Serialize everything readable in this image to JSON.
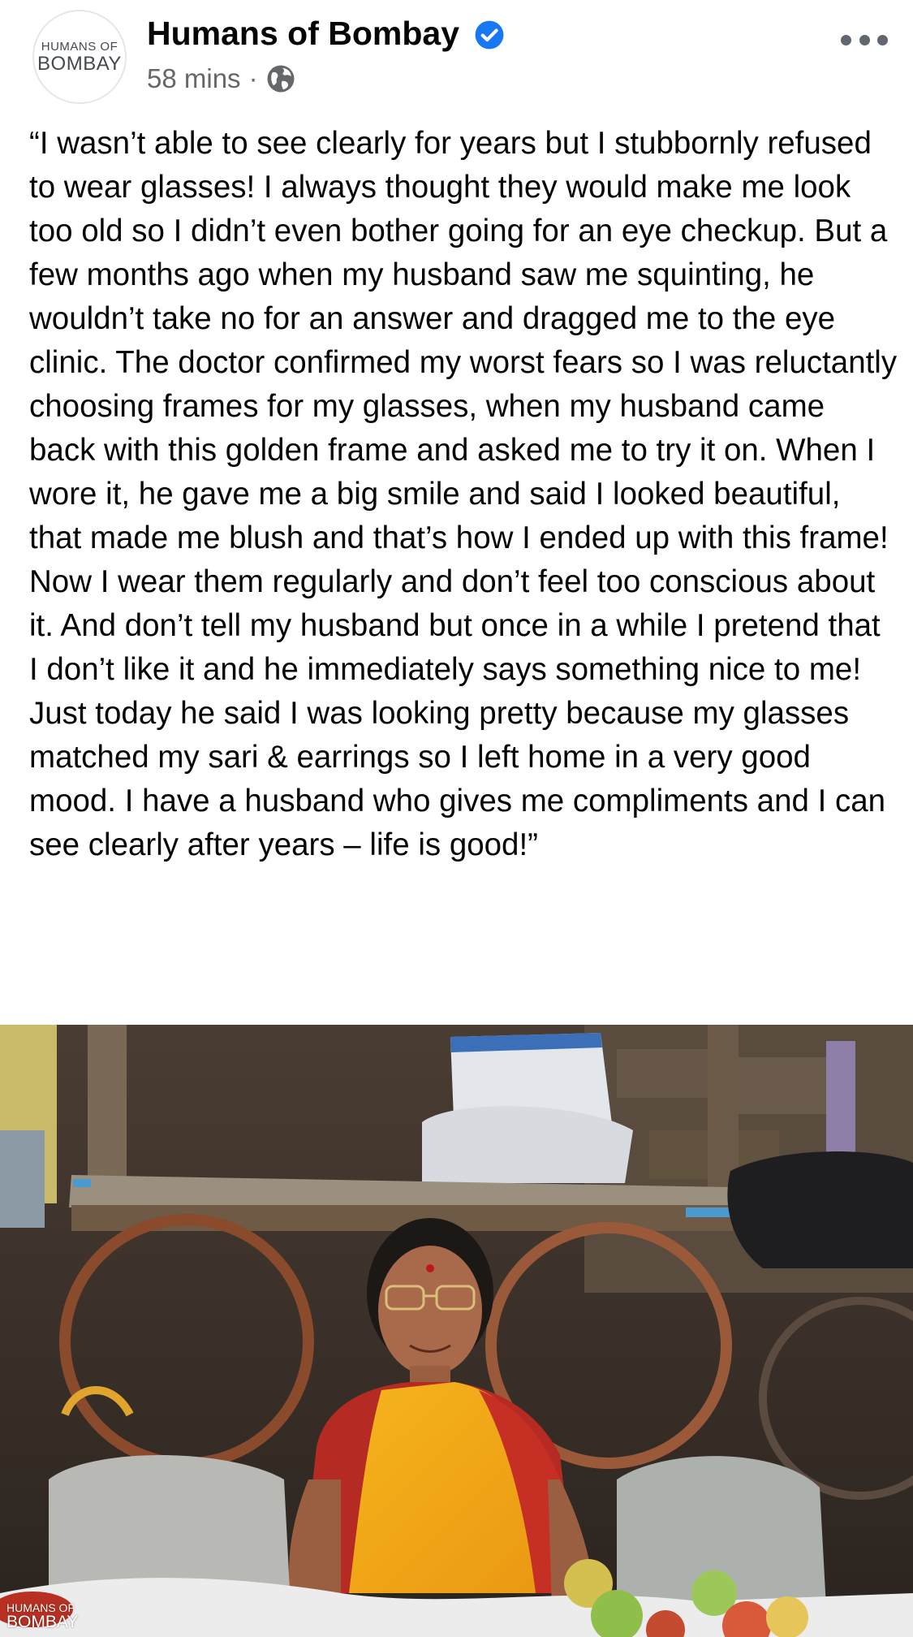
{
  "post": {
    "avatar": {
      "line1": "HUMANS OF",
      "line2": "BOMBAY"
    },
    "page_name": "Humans of Bombay",
    "timestamp": "58 mins",
    "separator": "·",
    "privacy_icon": "globe-icon",
    "verified_icon": "verified-badge-icon",
    "more_icon": "more-options-icon",
    "paragraphs": [
      "“I wasn’t able to see clearly for years but I stubbornly refused to wear glasses! I always thought they would make me look too old so I didn’t even bother going for an eye checkup. But a few months ago when my husband saw me squinting, he wouldn’t take no for an answer and dragged me to the eye clinic. The doctor confirmed my worst fears so I was reluctantly choosing frames for my glasses, when my husband came back with this golden frame and asked me to try it on. When I wore it, he gave me a big smile and said I looked beautiful, that made me blush and that’s how I ended up with this frame!",
      "Now I wear them regularly and don’t feel too conscious about it. And don’t tell my husband but once in a while I pretend that I don’t like it and he immediately says something nice to me! Just today he said I was looking pretty because my glasses matched my sari & earrings so I left home in a very good mood. I have a husband who gives me compliments and I can see clearly after years – life is good!”"
    ],
    "photo_watermark": {
      "line1": "HUMANS OF",
      "line2": "BOMBAY"
    }
  },
  "colors": {
    "verified_blue": "#1877f2",
    "meta_gray": "#65676b",
    "text": "#050505"
  }
}
